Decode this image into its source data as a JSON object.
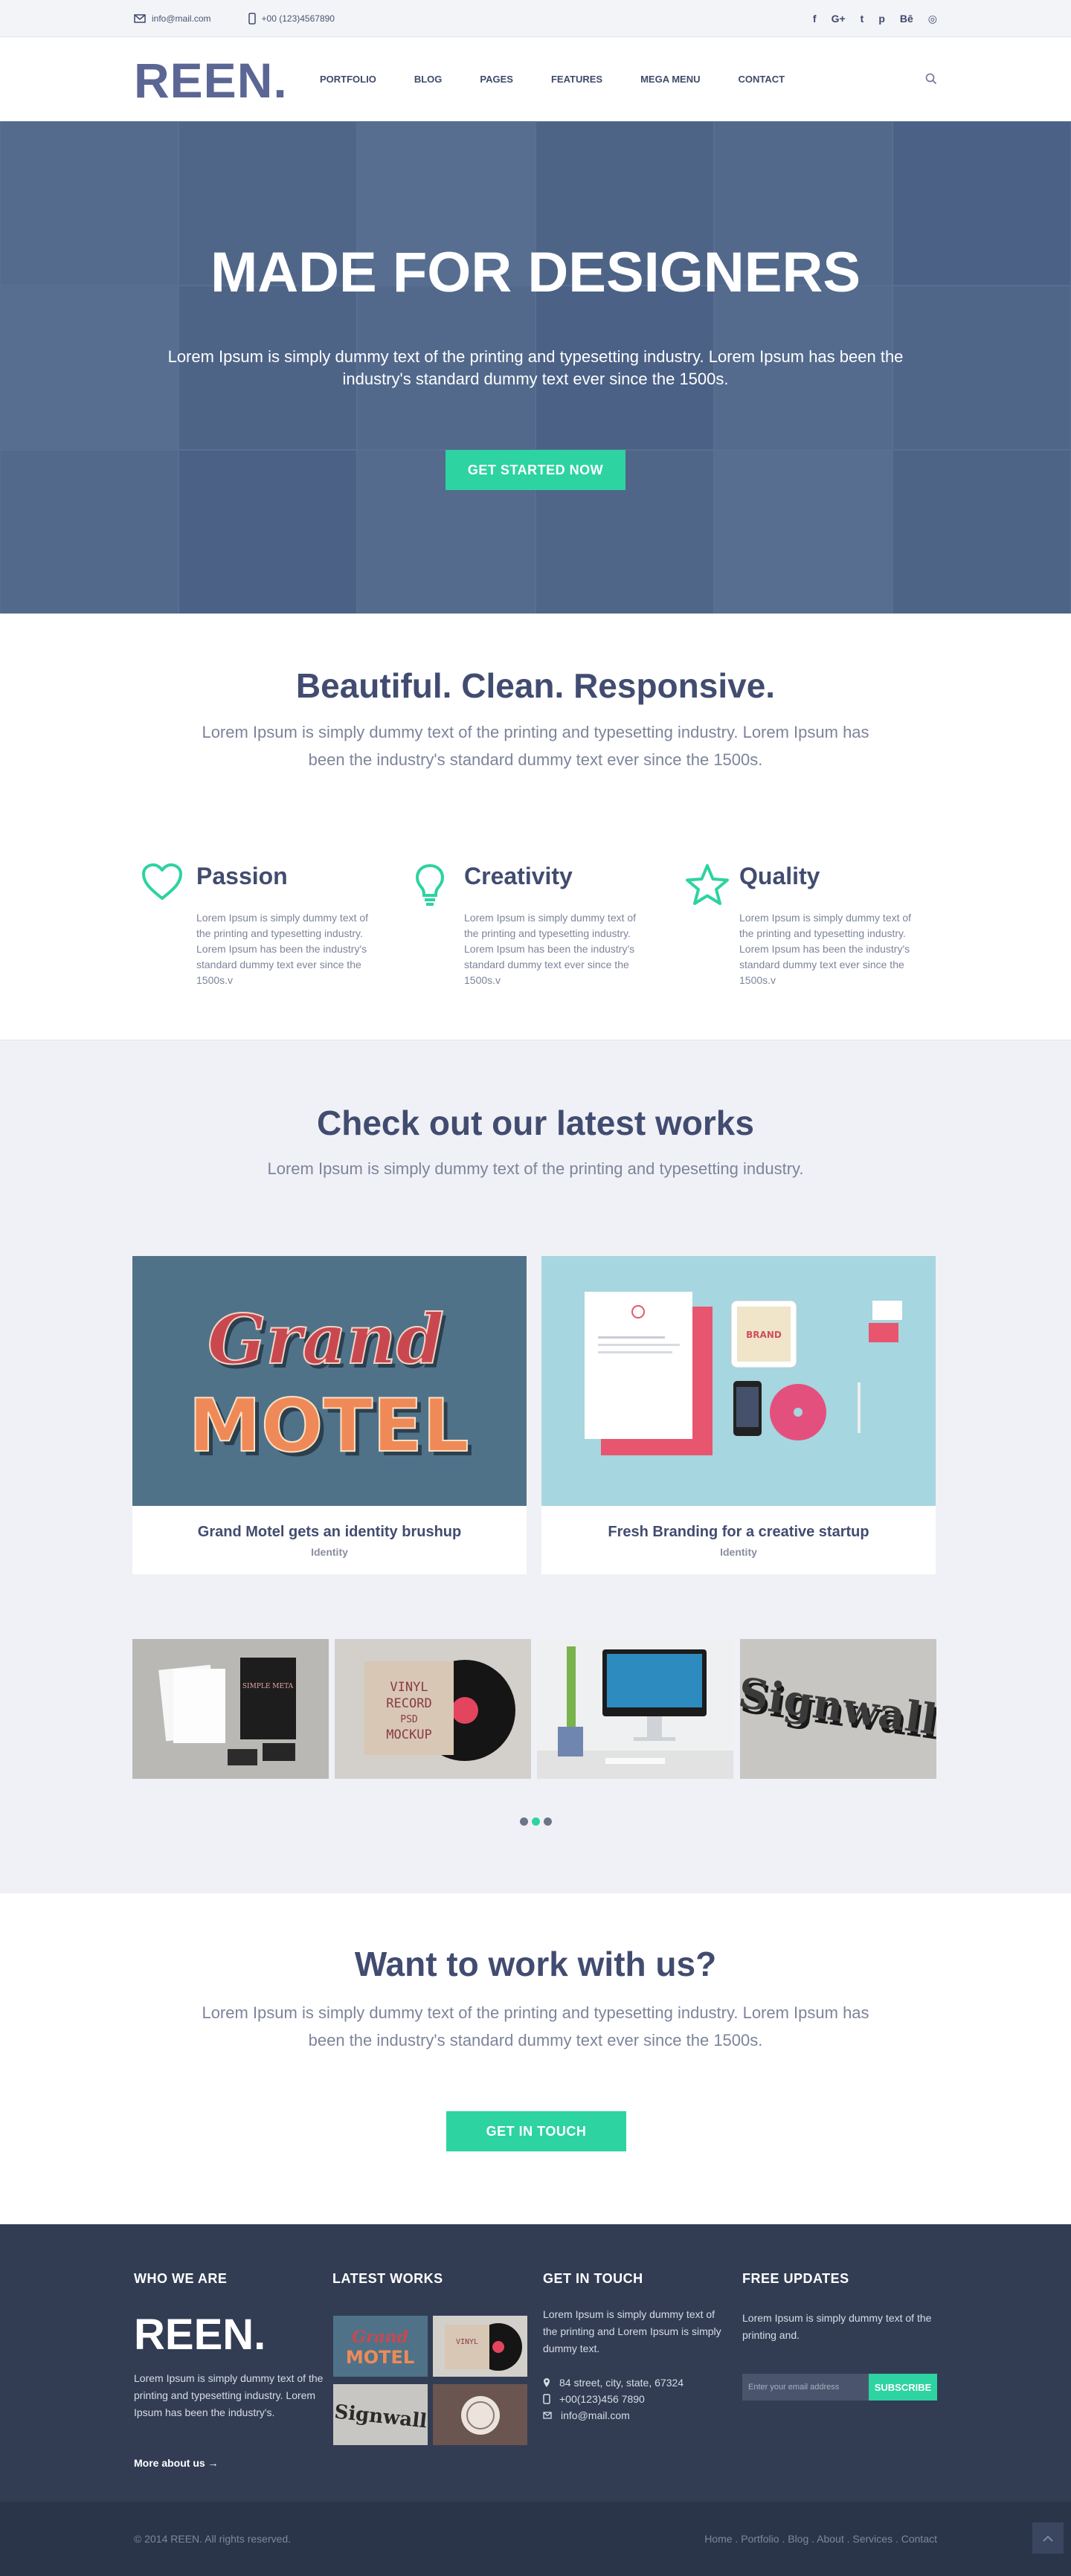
{
  "topbar": {
    "email": "info@mail.com",
    "phone": "+00 (123)4567890",
    "social": [
      "f",
      "G+",
      "t",
      "p",
      "Bē",
      "◎"
    ]
  },
  "header": {
    "logo": "REEN",
    "logo_dot": ".",
    "nav": [
      "PORTFOLIO",
      "BLOG",
      "PAGES",
      "FEATURES",
      "MEGA MENU",
      "CONTACT"
    ]
  },
  "hero": {
    "title": "MADE FOR DESIGNERS",
    "subtitle": "Lorem Ipsum is simply dummy text of the printing and typesetting industry. Lorem Ipsum has been the industry's standard dummy text ever since the 1500s.",
    "button": "GET STARTED NOW"
  },
  "intro": {
    "title": "Beautiful. Clean. Responsive.",
    "subtitle": "Lorem Ipsum is simply dummy text of the printing and typesetting industry. Lorem Ipsum has been the industry's standard dummy text ever since the 1500s."
  },
  "features": [
    {
      "title": "Passion",
      "icon": "heart-icon",
      "text": "Lorem Ipsum is simply dummy text of the printing and typesetting industry. Lorem Ipsum has been the industry's standard dummy text ever since the 1500s.v"
    },
    {
      "title": "Creativity",
      "icon": "lightbulb-icon",
      "text": "Lorem Ipsum is simply dummy text of the printing and typesetting industry. Lorem Ipsum has been the industry's standard dummy text ever since the 1500s.v"
    },
    {
      "title": "Quality",
      "icon": "star-icon",
      "text": "Lorem Ipsum is simply dummy text of the printing and typesetting industry. Lorem Ipsum has been the industry's standard dummy text ever since the 1500s.v"
    }
  ],
  "works": {
    "title": "Check out our latest works",
    "subtitle": "Lorem Ipsum is simply dummy text of the printing and typesetting industry.",
    "cards": [
      {
        "title": "Grand Motel gets an identity brushup",
        "category": "Identity",
        "art_line1": "Grand",
        "art_line2": "MOTEL"
      },
      {
        "title": "Fresh Branding for a creative startup",
        "category": "Identity",
        "art_line1": "BRAND"
      }
    ],
    "thumbs": [
      "Stationery mockup",
      "VINYL RECORD PSD MOCKUP",
      "Desktop mockup",
      "Signwall"
    ],
    "thumb_art": {
      "vinyl": [
        "VINYL",
        "RECORD",
        "PSD",
        "MOCKUP"
      ],
      "sign": "Signwall",
      "stationery": "SIMPLE META"
    },
    "active_slide": 2
  },
  "cta": {
    "title": "Want to work with us?",
    "subtitle": "Lorem Ipsum is simply dummy text of the printing and typesetting industry. Lorem Ipsum has been the industry's standard dummy text ever since the 1500s.",
    "button": "GET IN TOUCH"
  },
  "footer": {
    "who_title": "WHO WE ARE",
    "logo": "REEN.",
    "about": "Lorem Ipsum is simply dummy text of the printing and typesetting industry. Lorem Ipsum has been the industry's.",
    "more": "More about us →",
    "works_title": "LATEST WORKS",
    "thumb_art": [
      "Grand",
      "MOTEL",
      "VINYL",
      "Signwall"
    ],
    "touch_title": "GET IN TOUCH",
    "touch_text": "Lorem Ipsum is simply dummy text of the printing and Lorem Ipsum is simply dummy text.",
    "address": "84 street, city, state, 67324",
    "phone": "+00(123)456 7890",
    "email": "info@mail.com",
    "updates_title": "FREE UPDATES",
    "updates_text": "Lorem Ipsum is simply dummy text of the printing and.",
    "email_placeholder": "Enter your email address",
    "subscribe": "SUBSCRIBE"
  },
  "bottombar": {
    "copyright": "© 2014 REEN. All rights reserved.",
    "links": "Home . Portfolio . Blog . About . Services . Contact"
  },
  "colors": {
    "accent": "#2dd3a0",
    "heading": "#424c70",
    "footer": "#323d54",
    "logo": "#5b6694"
  }
}
